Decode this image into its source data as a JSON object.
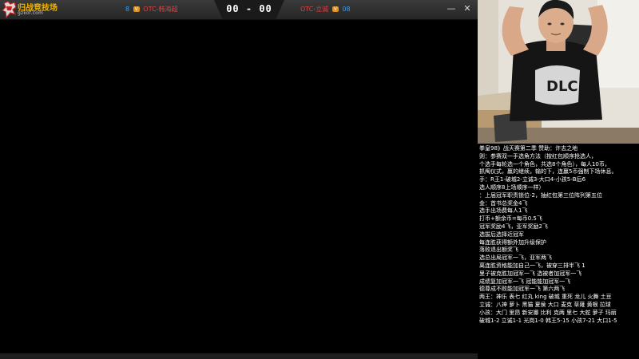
{
  "header": {
    "logo_text": "归战竞技场",
    "logo_sub": "gzkof.com",
    "score": "00 - 00",
    "left_player": {
      "num": "8",
      "badge": "V",
      "name": "OTC-韩海超"
    },
    "right_player": {
      "name": "OTC-立诚",
      "badge": "V",
      "num": "08"
    },
    "min_label": "—",
    "close_label": "✕"
  },
  "notes": {
    "lines": [
      "拳皇98》战天赛第二季 赞助：许志之地",
      "则：参赛双一手选角方法（按红包顺序抢选人，",
      "个选手每轮选一个角色，共选8个角色），每人10币，",
      "抓阄仪式，赢的继续，输的下，连赢5币强制下场休息。",
      "手：R王1-破城2-立诚3-大口4-小孩5-B后6",
      "选人顺序8上场顺序一样）",
      "：上届冠军职责锁位-2，抽红包第三位阵列第五位",
      "金：首书总奖金4飞",
      "选手出场费每人1飞",
      "打币+额余币=每币0.5飞",
      "冠军奖励4飞，亚军奖励2飞",
      "选拔后选择近冠军",
      "每连胜获得额外加升级保护",
      "落败退出额奖飞",
      "选总出局冠军一飞，亚军两飞",
      "离连胜资格能加自己一飞，被穿三排半飞 1",
      "里子被克胜加冠军一飞 选被者加冠军一飞",
      "成绩复加冠军一飞 冠能能加冠军一飞",
      "德尊成不败能加冠军一飞 第六两飞",
      "两王：神乐 表七 红丸 king 破城 重死 龙儿 火舞 土豆",
      "立诚：八神 萝卜 黑猫 夏侯 大口 麦克 草薙 黄根 拉球",
      "小孩：大门 里昂 新安娜 比利 克两 里七 大蛇 萝子 玛丽",
      "破城1-2 立诚1-1 光岗1-0 韩王5-15 小孩7-21 大口1-5"
    ]
  },
  "colors": {
    "brand": "#f0b400",
    "player_name": "#e04040",
    "player_num": "#2ea0ff",
    "badge": "#e09020"
  }
}
